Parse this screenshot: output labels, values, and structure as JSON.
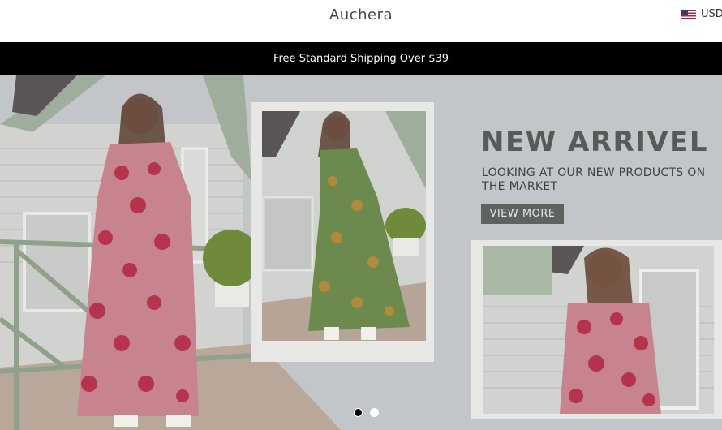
{
  "header": {
    "brand": "Auchera",
    "currency": {
      "code": "USD",
      "flag_icon": "us-flag-icon"
    }
  },
  "announcement": {
    "text": "Free Standard Shipping Over $39"
  },
  "hero": {
    "headline": "NEW ARRIVEL",
    "subline": "LOOKING AT OUR NEW PRODUCTS ON THE MARKET",
    "cta_label": "VIEW MORE",
    "slides": {
      "count": 2,
      "active_index": 0
    },
    "colors": {
      "backdrop": "#bfc3c6",
      "text": "#565a59",
      "cta_bg": "#5f6360"
    }
  }
}
